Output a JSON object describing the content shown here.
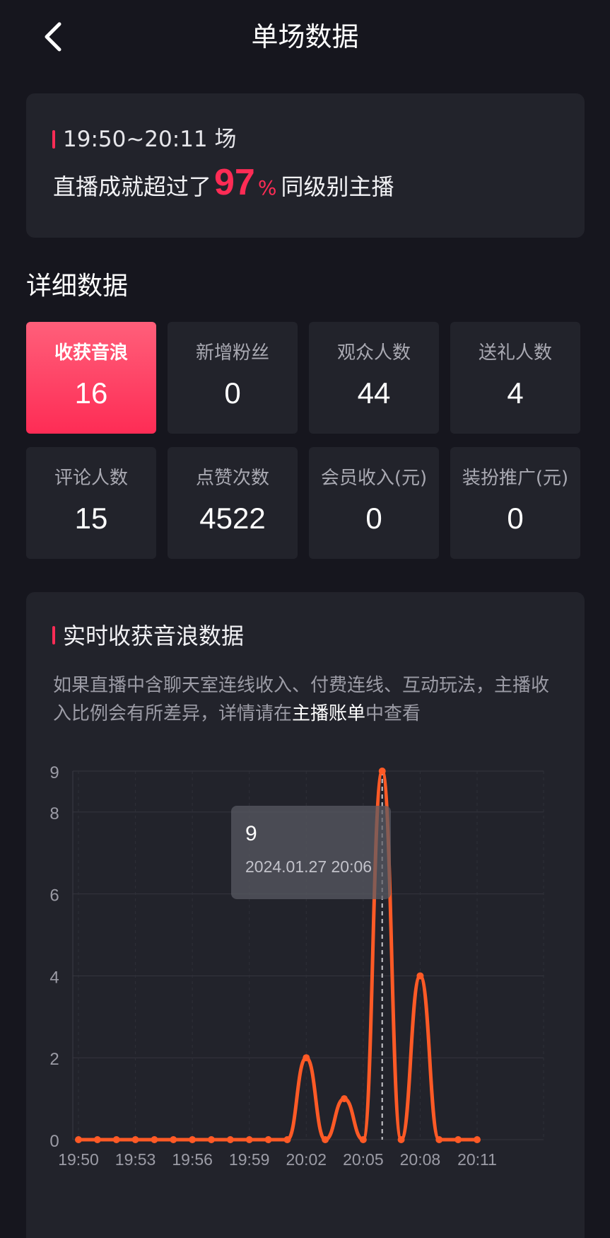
{
  "header": {
    "title": "单场数据",
    "back_icon": "chevron-left-icon"
  },
  "summary": {
    "session_time": "19:50~20:11 场",
    "achievement_prefix": "直播成就超过了",
    "achievement_percent": "97",
    "achievement_percent_sign": "%",
    "achievement_suffix": "同级别主播"
  },
  "details": {
    "title": "详细数据",
    "stats": [
      {
        "label": "收获音浪",
        "value": "16",
        "active": true
      },
      {
        "label": "新增粉丝",
        "value": "0",
        "active": false
      },
      {
        "label": "观众人数",
        "value": "44",
        "active": false
      },
      {
        "label": "送礼人数",
        "value": "4",
        "active": false
      },
      {
        "label": "评论人数",
        "value": "15",
        "active": false
      },
      {
        "label": "点赞次数",
        "value": "4522",
        "active": false
      },
      {
        "label": "会员收入(元)",
        "value": "0",
        "active": false
      },
      {
        "label": "装扮推广(元)",
        "value": "0",
        "active": false
      }
    ]
  },
  "realtime": {
    "title": "实时收获音浪数据",
    "desc_prefix": "如果直播中含聊天室连线收入、付费连线、互动玩法，主播收入比例会有所差异，详情请在",
    "desc_link": "主播账单",
    "desc_suffix": "中查看"
  },
  "colors": {
    "accent": "#fe2c55",
    "line": "#ff5a26",
    "background": "#16161e",
    "card": "#22232b"
  },
  "chart_data": {
    "type": "line",
    "x": [
      "19:50",
      "19:51",
      "19:52",
      "19:53",
      "19:54",
      "19:55",
      "19:56",
      "19:57",
      "19:58",
      "19:59",
      "20:00",
      "20:01",
      "20:02",
      "20:03",
      "20:04",
      "20:05",
      "20:06",
      "20:07",
      "20:08",
      "20:09",
      "20:10",
      "20:11"
    ],
    "values": [
      0,
      0,
      0,
      0,
      0,
      0,
      0,
      0,
      0,
      0,
      0,
      0,
      2,
      0,
      1,
      0,
      9,
      0,
      4,
      0,
      0,
      0
    ],
    "xticks": [
      "19:50",
      "19:53",
      "19:56",
      "19:59",
      "20:02",
      "20:05",
      "20:08",
      "20:11"
    ],
    "yticks": [
      0,
      2,
      4,
      6,
      8,
      9
    ],
    "ylim": [
      0,
      9
    ],
    "grid": true,
    "tooltip": {
      "index": 16,
      "value": "9",
      "time": "2024.01.27 20:06"
    }
  }
}
